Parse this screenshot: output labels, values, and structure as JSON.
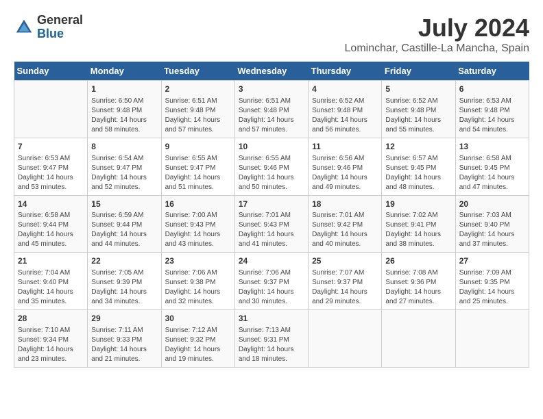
{
  "logo": {
    "general": "General",
    "blue": "Blue"
  },
  "title": "July 2024",
  "location": "Lominchar, Castille-La Mancha, Spain",
  "days_of_week": [
    "Sunday",
    "Monday",
    "Tuesday",
    "Wednesday",
    "Thursday",
    "Friday",
    "Saturday"
  ],
  "weeks": [
    [
      {
        "day": "",
        "info": ""
      },
      {
        "day": "1",
        "info": "Sunrise: 6:50 AM\nSunset: 9:48 PM\nDaylight: 14 hours\nand 58 minutes."
      },
      {
        "day": "2",
        "info": "Sunrise: 6:51 AM\nSunset: 9:48 PM\nDaylight: 14 hours\nand 57 minutes."
      },
      {
        "day": "3",
        "info": "Sunrise: 6:51 AM\nSunset: 9:48 PM\nDaylight: 14 hours\nand 57 minutes."
      },
      {
        "day": "4",
        "info": "Sunrise: 6:52 AM\nSunset: 9:48 PM\nDaylight: 14 hours\nand 56 minutes."
      },
      {
        "day": "5",
        "info": "Sunrise: 6:52 AM\nSunset: 9:48 PM\nDaylight: 14 hours\nand 55 minutes."
      },
      {
        "day": "6",
        "info": "Sunrise: 6:53 AM\nSunset: 9:48 PM\nDaylight: 14 hours\nand 54 minutes."
      }
    ],
    [
      {
        "day": "7",
        "info": "Sunrise: 6:53 AM\nSunset: 9:47 PM\nDaylight: 14 hours\nand 53 minutes."
      },
      {
        "day": "8",
        "info": "Sunrise: 6:54 AM\nSunset: 9:47 PM\nDaylight: 14 hours\nand 52 minutes."
      },
      {
        "day": "9",
        "info": "Sunrise: 6:55 AM\nSunset: 9:47 PM\nDaylight: 14 hours\nand 51 minutes."
      },
      {
        "day": "10",
        "info": "Sunrise: 6:55 AM\nSunset: 9:46 PM\nDaylight: 14 hours\nand 50 minutes."
      },
      {
        "day": "11",
        "info": "Sunrise: 6:56 AM\nSunset: 9:46 PM\nDaylight: 14 hours\nand 49 minutes."
      },
      {
        "day": "12",
        "info": "Sunrise: 6:57 AM\nSunset: 9:45 PM\nDaylight: 14 hours\nand 48 minutes."
      },
      {
        "day": "13",
        "info": "Sunrise: 6:58 AM\nSunset: 9:45 PM\nDaylight: 14 hours\nand 47 minutes."
      }
    ],
    [
      {
        "day": "14",
        "info": "Sunrise: 6:58 AM\nSunset: 9:44 PM\nDaylight: 14 hours\nand 45 minutes."
      },
      {
        "day": "15",
        "info": "Sunrise: 6:59 AM\nSunset: 9:44 PM\nDaylight: 14 hours\nand 44 minutes."
      },
      {
        "day": "16",
        "info": "Sunrise: 7:00 AM\nSunset: 9:43 PM\nDaylight: 14 hours\nand 43 minutes."
      },
      {
        "day": "17",
        "info": "Sunrise: 7:01 AM\nSunset: 9:43 PM\nDaylight: 14 hours\nand 41 minutes."
      },
      {
        "day": "18",
        "info": "Sunrise: 7:01 AM\nSunset: 9:42 PM\nDaylight: 14 hours\nand 40 minutes."
      },
      {
        "day": "19",
        "info": "Sunrise: 7:02 AM\nSunset: 9:41 PM\nDaylight: 14 hours\nand 38 minutes."
      },
      {
        "day": "20",
        "info": "Sunrise: 7:03 AM\nSunset: 9:40 PM\nDaylight: 14 hours\nand 37 minutes."
      }
    ],
    [
      {
        "day": "21",
        "info": "Sunrise: 7:04 AM\nSunset: 9:40 PM\nDaylight: 14 hours\nand 35 minutes."
      },
      {
        "day": "22",
        "info": "Sunrise: 7:05 AM\nSunset: 9:39 PM\nDaylight: 14 hours\nand 34 minutes."
      },
      {
        "day": "23",
        "info": "Sunrise: 7:06 AM\nSunset: 9:38 PM\nDaylight: 14 hours\nand 32 minutes."
      },
      {
        "day": "24",
        "info": "Sunrise: 7:06 AM\nSunset: 9:37 PM\nDaylight: 14 hours\nand 30 minutes."
      },
      {
        "day": "25",
        "info": "Sunrise: 7:07 AM\nSunset: 9:37 PM\nDaylight: 14 hours\nand 29 minutes."
      },
      {
        "day": "26",
        "info": "Sunrise: 7:08 AM\nSunset: 9:36 PM\nDaylight: 14 hours\nand 27 minutes."
      },
      {
        "day": "27",
        "info": "Sunrise: 7:09 AM\nSunset: 9:35 PM\nDaylight: 14 hours\nand 25 minutes."
      }
    ],
    [
      {
        "day": "28",
        "info": "Sunrise: 7:10 AM\nSunset: 9:34 PM\nDaylight: 14 hours\nand 23 minutes."
      },
      {
        "day": "29",
        "info": "Sunrise: 7:11 AM\nSunset: 9:33 PM\nDaylight: 14 hours\nand 21 minutes."
      },
      {
        "day": "30",
        "info": "Sunrise: 7:12 AM\nSunset: 9:32 PM\nDaylight: 14 hours\nand 19 minutes."
      },
      {
        "day": "31",
        "info": "Sunrise: 7:13 AM\nSunset: 9:31 PM\nDaylight: 14 hours\nand 18 minutes."
      },
      {
        "day": "",
        "info": ""
      },
      {
        "day": "",
        "info": ""
      },
      {
        "day": "",
        "info": ""
      }
    ]
  ]
}
